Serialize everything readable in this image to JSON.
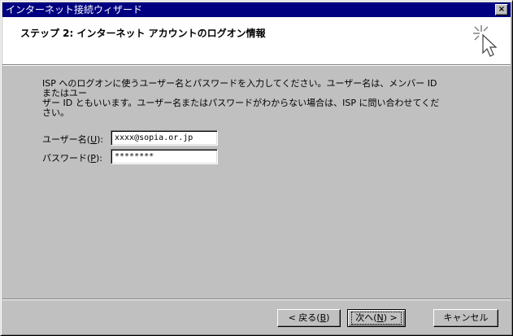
{
  "window": {
    "title": "インターネット接続ウィザード",
    "close_glyph": "×"
  },
  "header": {
    "title": "ステップ 2: インターネット アカウントのログオン情報",
    "icon": "wizard-cursor-icon"
  },
  "description": {
    "line1": "ISP へのログオンに使うユーザー名とパスワードを入力してください。ユーザー名は、メンバー ID またはユー",
    "line2": "ザー ID ともいいます。ユーザー名またはパスワードがわからない場合は、ISP に問い合わせてください。"
  },
  "form": {
    "username_label": "ユーザー名(",
    "username_accesskey": "U",
    "username_label_end": "):",
    "username_value": "xxxx@sopia.or.jp",
    "password_label": "パスワード(",
    "password_accesskey": "P",
    "password_label_end": "):",
    "password_value": "********"
  },
  "buttons": {
    "back_prefix": "< 戻る(",
    "back_key": "B",
    "back_suffix": ")",
    "next_prefix": "次へ(",
    "next_key": "N",
    "next_suffix": ") >",
    "cancel": "キャンセル"
  },
  "colors": {
    "titlebar": "#000080",
    "face": "#c0c0c0",
    "header_bg": "#ffffff"
  }
}
